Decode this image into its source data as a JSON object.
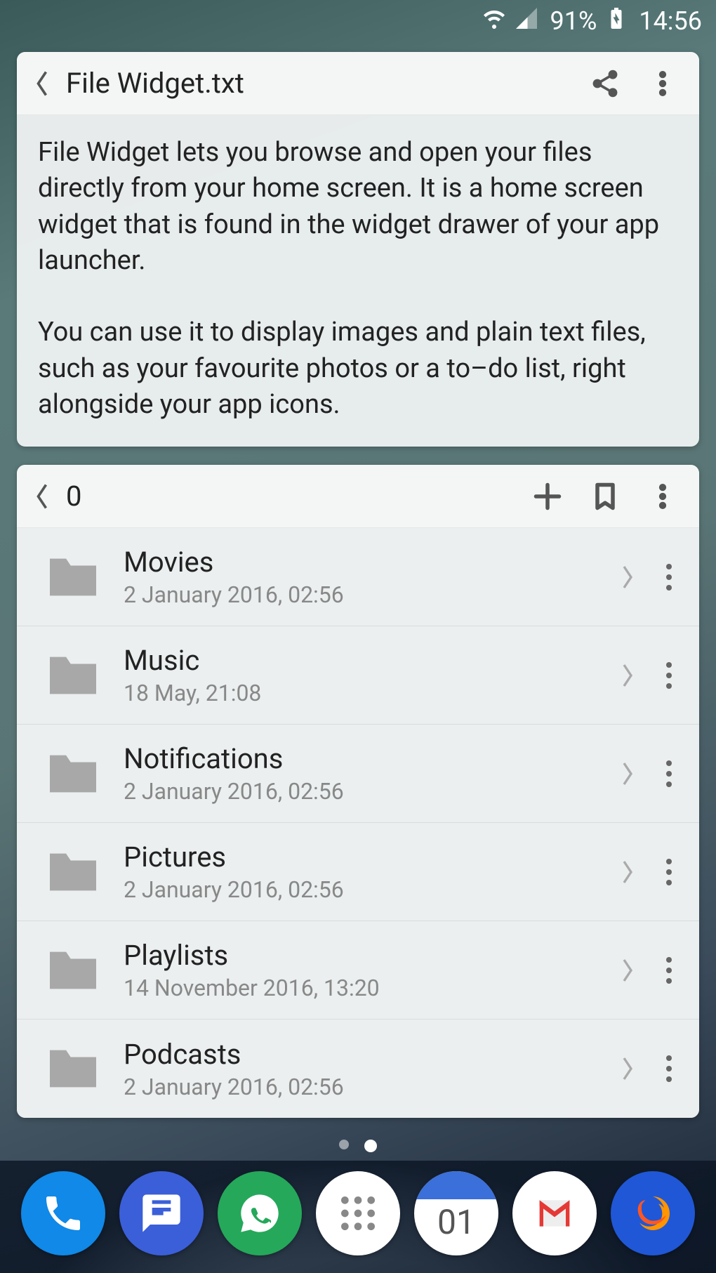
{
  "status_bar": {
    "battery_percent": "91%",
    "time": "14:56"
  },
  "text_widget": {
    "title": "File Widget.txt",
    "body": "File Widget lets you browse and open your files directly from your home screen. It is a home screen widget that is found in the widget drawer of your app launcher.\n\nYou can use it to display images and plain text files, such as your favourite photos or a to–do list, right alongside your app icons."
  },
  "browser_widget": {
    "title": "0",
    "items": [
      {
        "name": "Movies",
        "date": "2 January 2016, 02:56"
      },
      {
        "name": "Music",
        "date": "18 May, 21:08"
      },
      {
        "name": "Notifications",
        "date": "2 January 2016, 02:56"
      },
      {
        "name": "Pictures",
        "date": "2 January 2016, 02:56"
      },
      {
        "name": "Playlists",
        "date": "14 November 2016, 13:20"
      },
      {
        "name": "Podcasts",
        "date": "2 January 2016, 02:56"
      }
    ]
  },
  "dock": {
    "calendar_day": "01"
  }
}
